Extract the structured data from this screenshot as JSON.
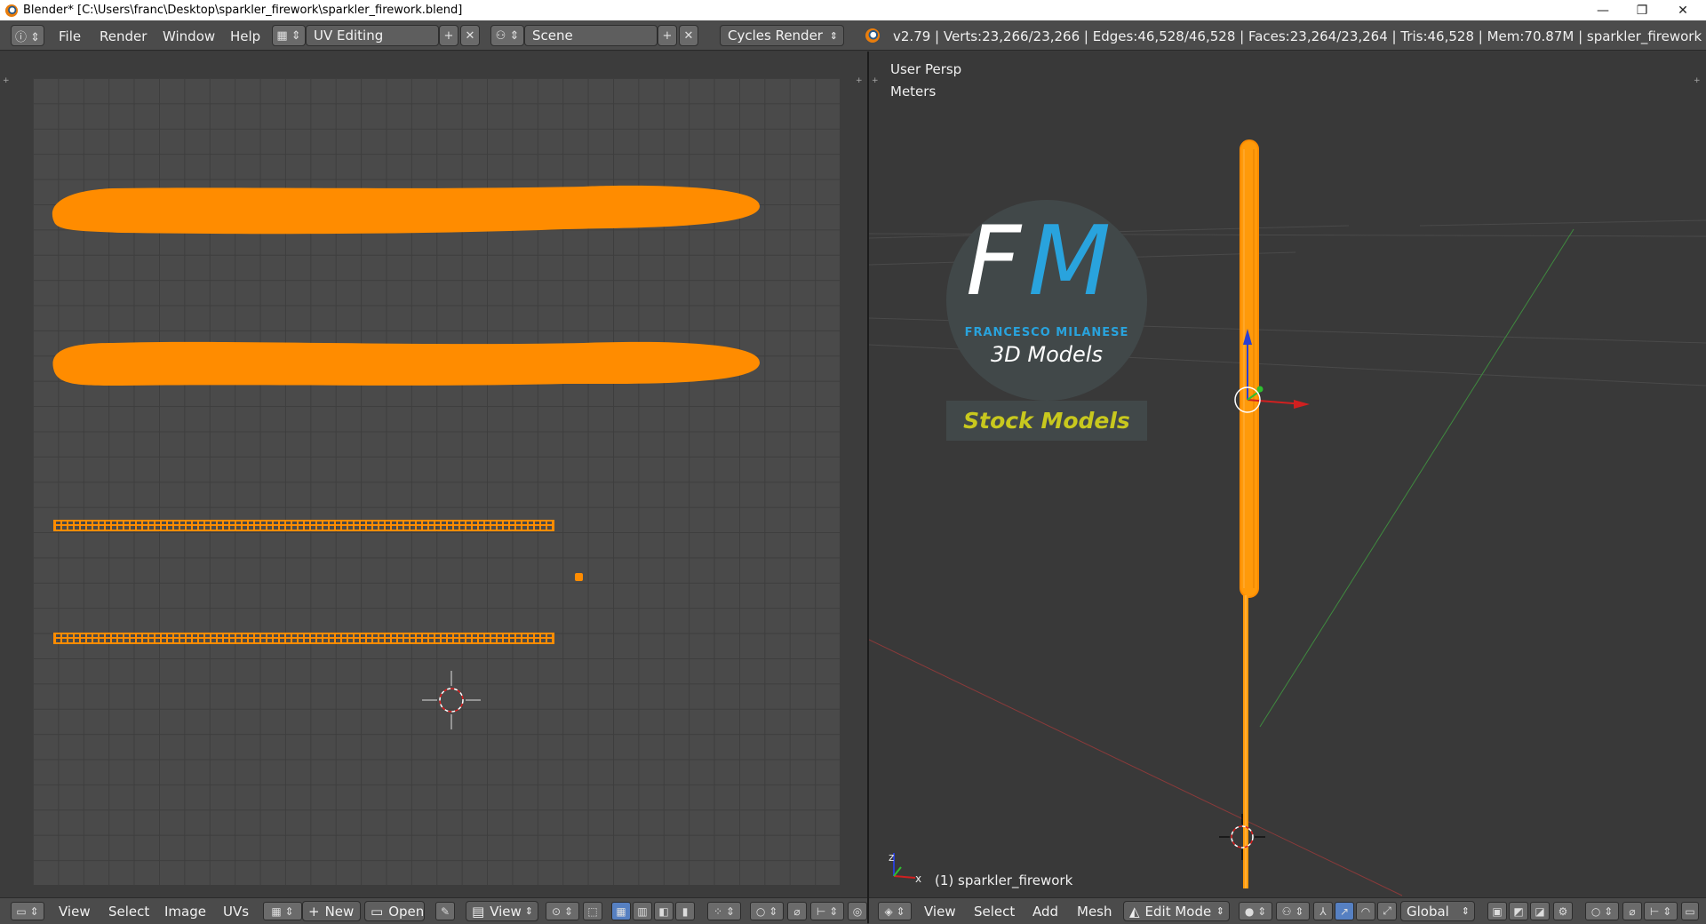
{
  "window": {
    "title": "Blender* [C:\\Users\\franc\\Desktop\\sparkler_firework\\sparkler_firework.blend]",
    "minimize": "—",
    "restore": "❐",
    "close": "✕"
  },
  "topbar": {
    "menus": [
      "File",
      "Render",
      "Window",
      "Help"
    ],
    "layout": "UV Editing",
    "scene": "Scene",
    "engine": "Cycles Render",
    "stats": "v2.79 | Verts:23,266/23,266 | Edges:46,528/46,528 | Faces:23,264/23,264 | Tris:46,528 | Mem:70.87M | sparkler_firework"
  },
  "uv_editor": {
    "menus": [
      "View",
      "Select",
      "Image",
      "UVs"
    ],
    "new_label": "New",
    "open_label": "Open",
    "view_label": "View"
  },
  "viewport": {
    "view_name": "User Persp",
    "units": "Meters",
    "object_label": "(1) sparkler_firework",
    "menus": [
      "View",
      "Select",
      "Add",
      "Mesh"
    ],
    "mode": "Edit Mode",
    "orientation": "Global",
    "axis_x": "x",
    "axis_z": "z"
  },
  "watermark": {
    "letters_f": "F",
    "letters_m": "M",
    "name": "FRANCESCO MILANESE",
    "subtitle": "3D Models",
    "banner": "Stock Models"
  },
  "colors": {
    "accent_orange": "#ff8c00",
    "watermark_blue": "#29a3dd",
    "banner_yellow": "#c8c81e"
  }
}
